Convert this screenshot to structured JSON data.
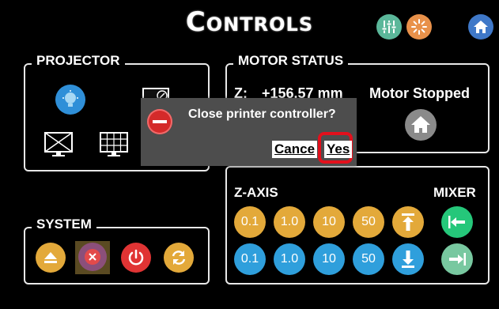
{
  "header": {
    "title": "Controls",
    "buttons": [
      {
        "icon": "sliders-icon",
        "color": "#5bb79a"
      },
      {
        "icon": "sun-burst-icon",
        "color": "#e8914a"
      },
      {
        "icon": "home-icon",
        "color": "#3f78c8"
      }
    ]
  },
  "projector": {
    "legend": "PROJECTOR",
    "icons": [
      "light-bulb-icon",
      "calibration-icon",
      "blank-screen-icon",
      "grid-screen-icon"
    ]
  },
  "motor_status": {
    "legend": "MOTOR STATUS",
    "z_label": "Z:",
    "z_value": "+156.57 mm",
    "state": "Motor Stopped",
    "home_icon": "home-motor-icon"
  },
  "system": {
    "legend": "SYSTEM",
    "buttons": [
      "eject-icon",
      "close-icon",
      "power-icon",
      "refresh-icon"
    ]
  },
  "zaxis": {
    "label": "Z-AXIS",
    "up_steps": [
      "0.1",
      "1.0",
      "10",
      "50"
    ],
    "down_steps": [
      "0.1",
      "1.0",
      "10",
      "50"
    ],
    "top_icon": "move-to-top-icon",
    "bottom_icon": "move-to-bottom-icon"
  },
  "mixer": {
    "label": "MIXER",
    "left_icon": "mixer-left-icon",
    "right_icon": "mixer-right-icon"
  },
  "dialog": {
    "message": "Close printer controller?",
    "cancel_label": "Cance",
    "yes_label": "Yes",
    "icon": "stop-icon"
  },
  "colors": {
    "gold": "#e3a93a",
    "blue": "#2f9fdc",
    "highlight": "#e3101c"
  }
}
